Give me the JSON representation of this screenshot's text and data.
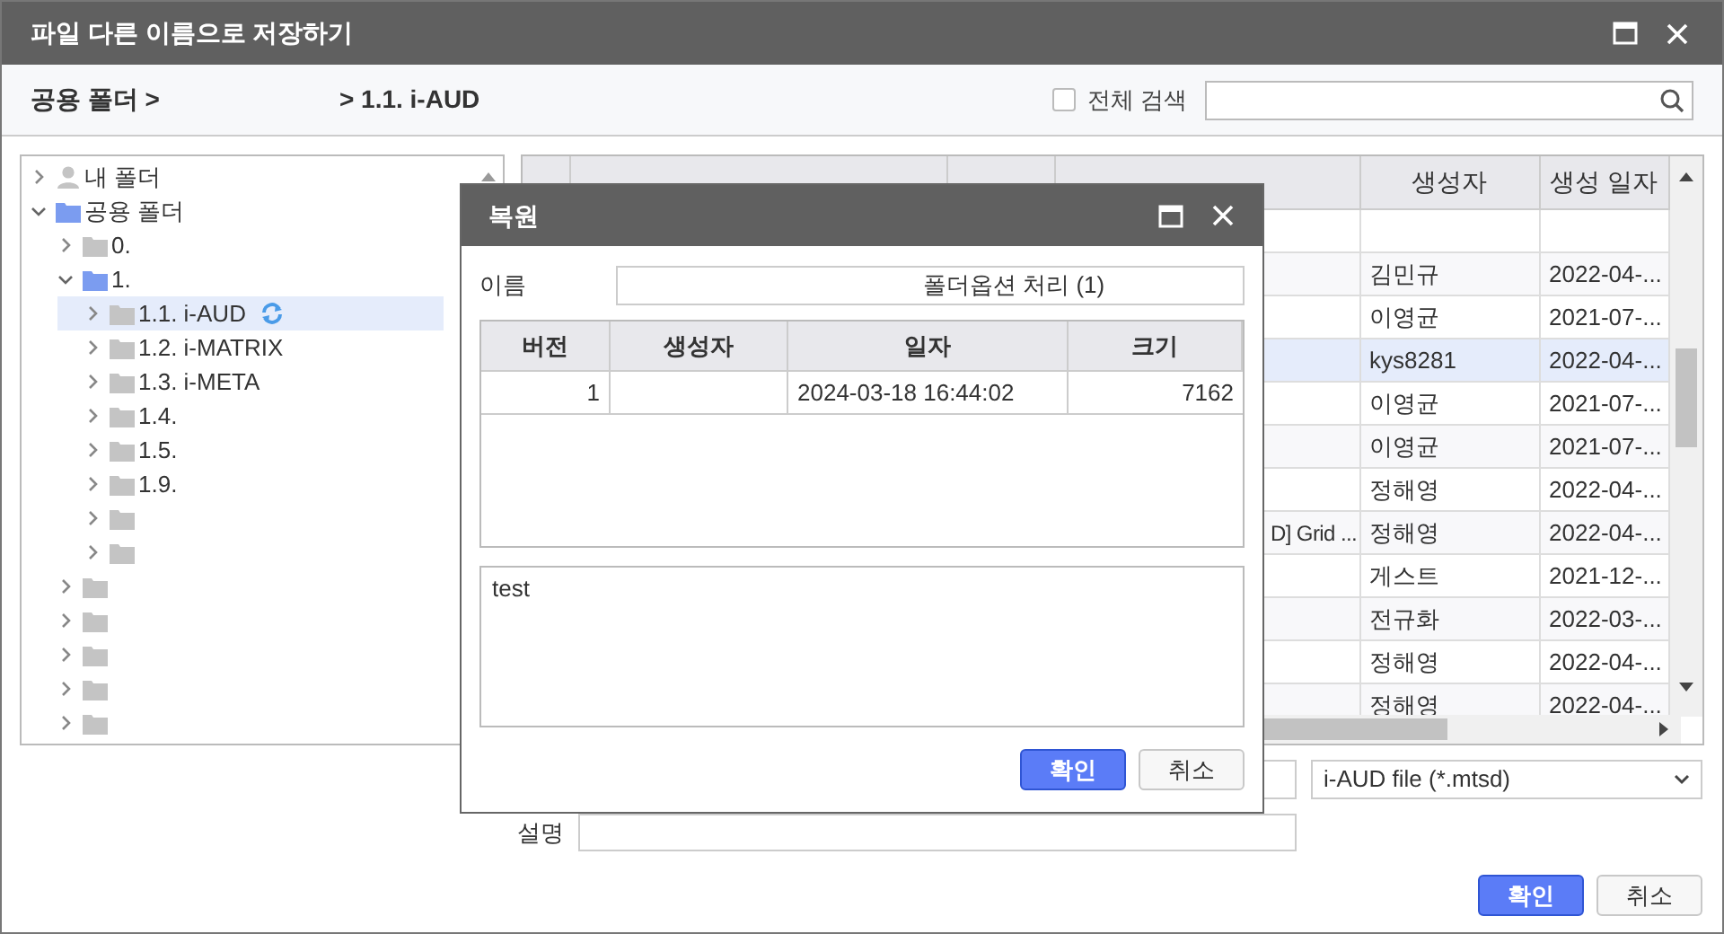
{
  "window": {
    "title": "파일 다른 이름으로 저장하기"
  },
  "breadcrumb": [
    "공용 폴더 >",
    "> 1.1. i-AUD"
  ],
  "all_search": {
    "label": "전체 검색",
    "checked": false
  },
  "tree": [
    {
      "label": "내 폴더",
      "kind": "user",
      "expanded": false,
      "selected": false
    },
    {
      "label": "공용 폴더",
      "kind": "folder",
      "expanded": true,
      "selected": false,
      "children": [
        {
          "label": "0.",
          "kind": "folder",
          "expanded": false,
          "selected": false
        },
        {
          "label": "1.",
          "kind": "folder",
          "expanded": true,
          "selected": false,
          "children": [
            {
              "label": "1.1. i-AUD",
              "kind": "folder",
              "expanded": false,
              "selected": true,
              "sync": true
            },
            {
              "label": "1.2. i-MATRIX",
              "kind": "folder",
              "expanded": false,
              "selected": false
            },
            {
              "label": "1.3. i-META",
              "kind": "folder",
              "expanded": false,
              "selected": false
            },
            {
              "label": "1.4.",
              "kind": "folder",
              "expanded": false,
              "selected": false
            },
            {
              "label": "1.5.",
              "kind": "folder",
              "expanded": false,
              "selected": false
            },
            {
              "label": "1.9.",
              "kind": "folder",
              "expanded": false,
              "selected": false
            },
            {
              "kind": "folder",
              "expanded": false,
              "selected": false
            },
            {
              "kind": "folder",
              "expanded": false,
              "selected": false
            }
          ]
        },
        {
          "kind": "folder",
          "expanded": false,
          "selected": false
        },
        {
          "kind": "folder",
          "expanded": false,
          "selected": false
        },
        {
          "kind": "folder",
          "expanded": false,
          "selected": false
        },
        {
          "kind": "folder",
          "expanded": false,
          "selected": false
        },
        {
          "kind": "folder",
          "expanded": false,
          "selected": false
        }
      ]
    }
  ],
  "grid": {
    "columns": [
      "생성자",
      "생성 일자"
    ],
    "rows": [
      {
        "selected": false
      },
      {
        "creator": "김민규",
        "created": "2022-04-...",
        "selected": false
      },
      {
        "creator": "이영균",
        "created": "2021-07-...",
        "selected": false
      },
      {
        "creator": "kys8281",
        "created": "2022-04-...",
        "selected": true
      },
      {
        "creator": "이영균",
        "created": "2021-07-...",
        "selected": false
      },
      {
        "creator": "이영균",
        "created": "2021-07-...",
        "selected": false
      },
      {
        "creator": "정해영",
        "created": "2022-04-...",
        "selected": false
      },
      {
        "description": "D] Grid ...",
        "creator": "정해영",
        "created": "2022-04-...",
        "selected": false
      },
      {
        "creator": "게스트",
        "created": "2021-12-...",
        "selected": false
      },
      {
        "creator": "전규화",
        "created": "2022-03-...",
        "selected": false
      },
      {
        "creator": "정해영",
        "created": "2022-04-...",
        "selected": false
      },
      {
        "creator": "정해영",
        "created": "2022-04-...",
        "selected": false
      }
    ]
  },
  "file_type": "i-AUD file (*.mtsd)",
  "description_label": "설명",
  "buttons": [
    {
      "label": "확인",
      "kind": "primary"
    },
    {
      "label": "취소",
      "kind": "secondary"
    }
  ],
  "restore_dialog": {
    "title": "복원",
    "name_label": "이름",
    "name_value": "폴더옵션 처리 (1)",
    "versions": {
      "columns": [
        "버전",
        "생성자",
        "일자",
        "크기"
      ],
      "rows": [
        {
          "version": "1",
          "date": "2024-03-18 16:44:02",
          "size": "7162"
        }
      ]
    },
    "comment": "test",
    "buttons": [
      {
        "label": "확인",
        "kind": "primary"
      },
      {
        "label": "취소",
        "kind": "secondary"
      }
    ]
  }
}
